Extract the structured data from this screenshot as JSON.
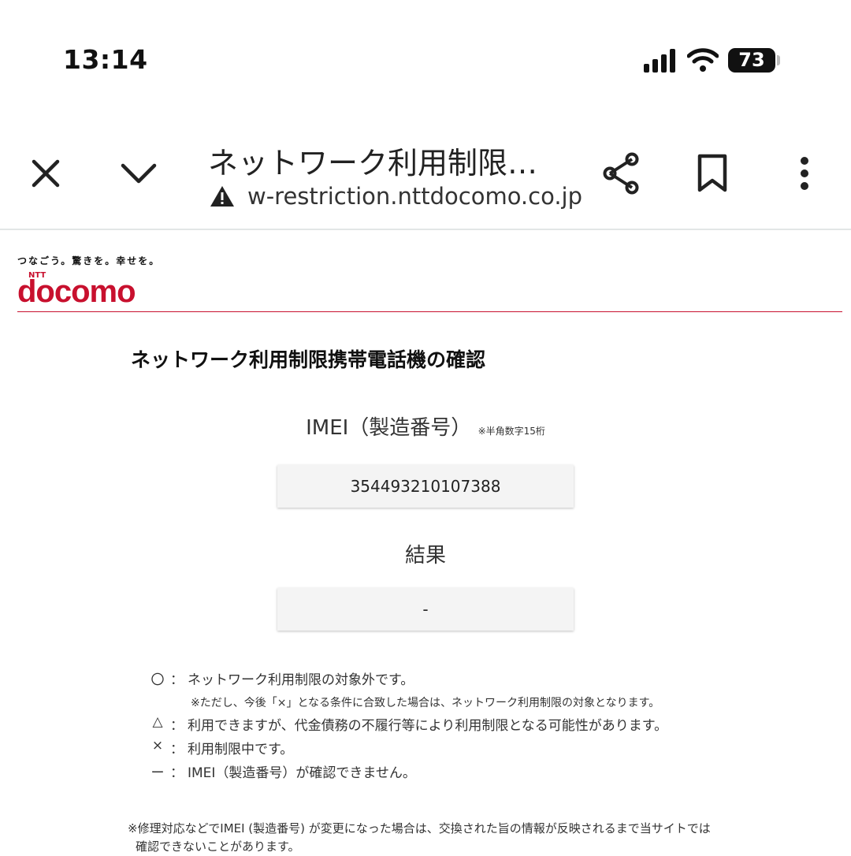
{
  "status_bar": {
    "time": "13:14",
    "battery": "73"
  },
  "browser": {
    "page_title": "ネットワーク利用制限…",
    "url": "w-restriction.nttdocomo.co.jp",
    "icons": [
      "close-icon",
      "chevron-down-icon",
      "warning-icon",
      "share-icon",
      "bookmark-icon",
      "more-vert-icon"
    ]
  },
  "logo": {
    "tagline": "つなごう。驚きを。幸せを。",
    "ntt": "NTT",
    "brand": "docomo",
    "brand_color": "#c8102e"
  },
  "main": {
    "heading": "ネットワーク利用制限携帯電話機の確認",
    "imei_label": "IMEI（製造番号）",
    "imei_note": "※半角数字15桁",
    "imei_value": "354493210107388",
    "result_label": "結果",
    "result_value": "-"
  },
  "legend": [
    {
      "symbol": "〇",
      "colon": "：",
      "text": "ネットワーク利用制限の対象外です。"
    },
    {
      "sub": "※ただし、今後「×」となる条件に合致した場合は、ネットワーク利用制限の対象となります。"
    },
    {
      "symbol": "△",
      "colon": "：",
      "text": "利用できますが、代金債務の不履行等により利用制限となる可能性があります。"
    },
    {
      "symbol": "×",
      "colon": "：",
      "text": "利用制限中です。"
    },
    {
      "symbol": "ー",
      "colon": "：",
      "text": "IMEI（製造番号）が確認できません。"
    }
  ],
  "footnote": {
    "line1": "※修理対応などでIMEI (製造番号) が変更になった場合は、交換された旨の情報が反映されるまで当サイトでは",
    "line2": "確認できないことがあります。"
  }
}
